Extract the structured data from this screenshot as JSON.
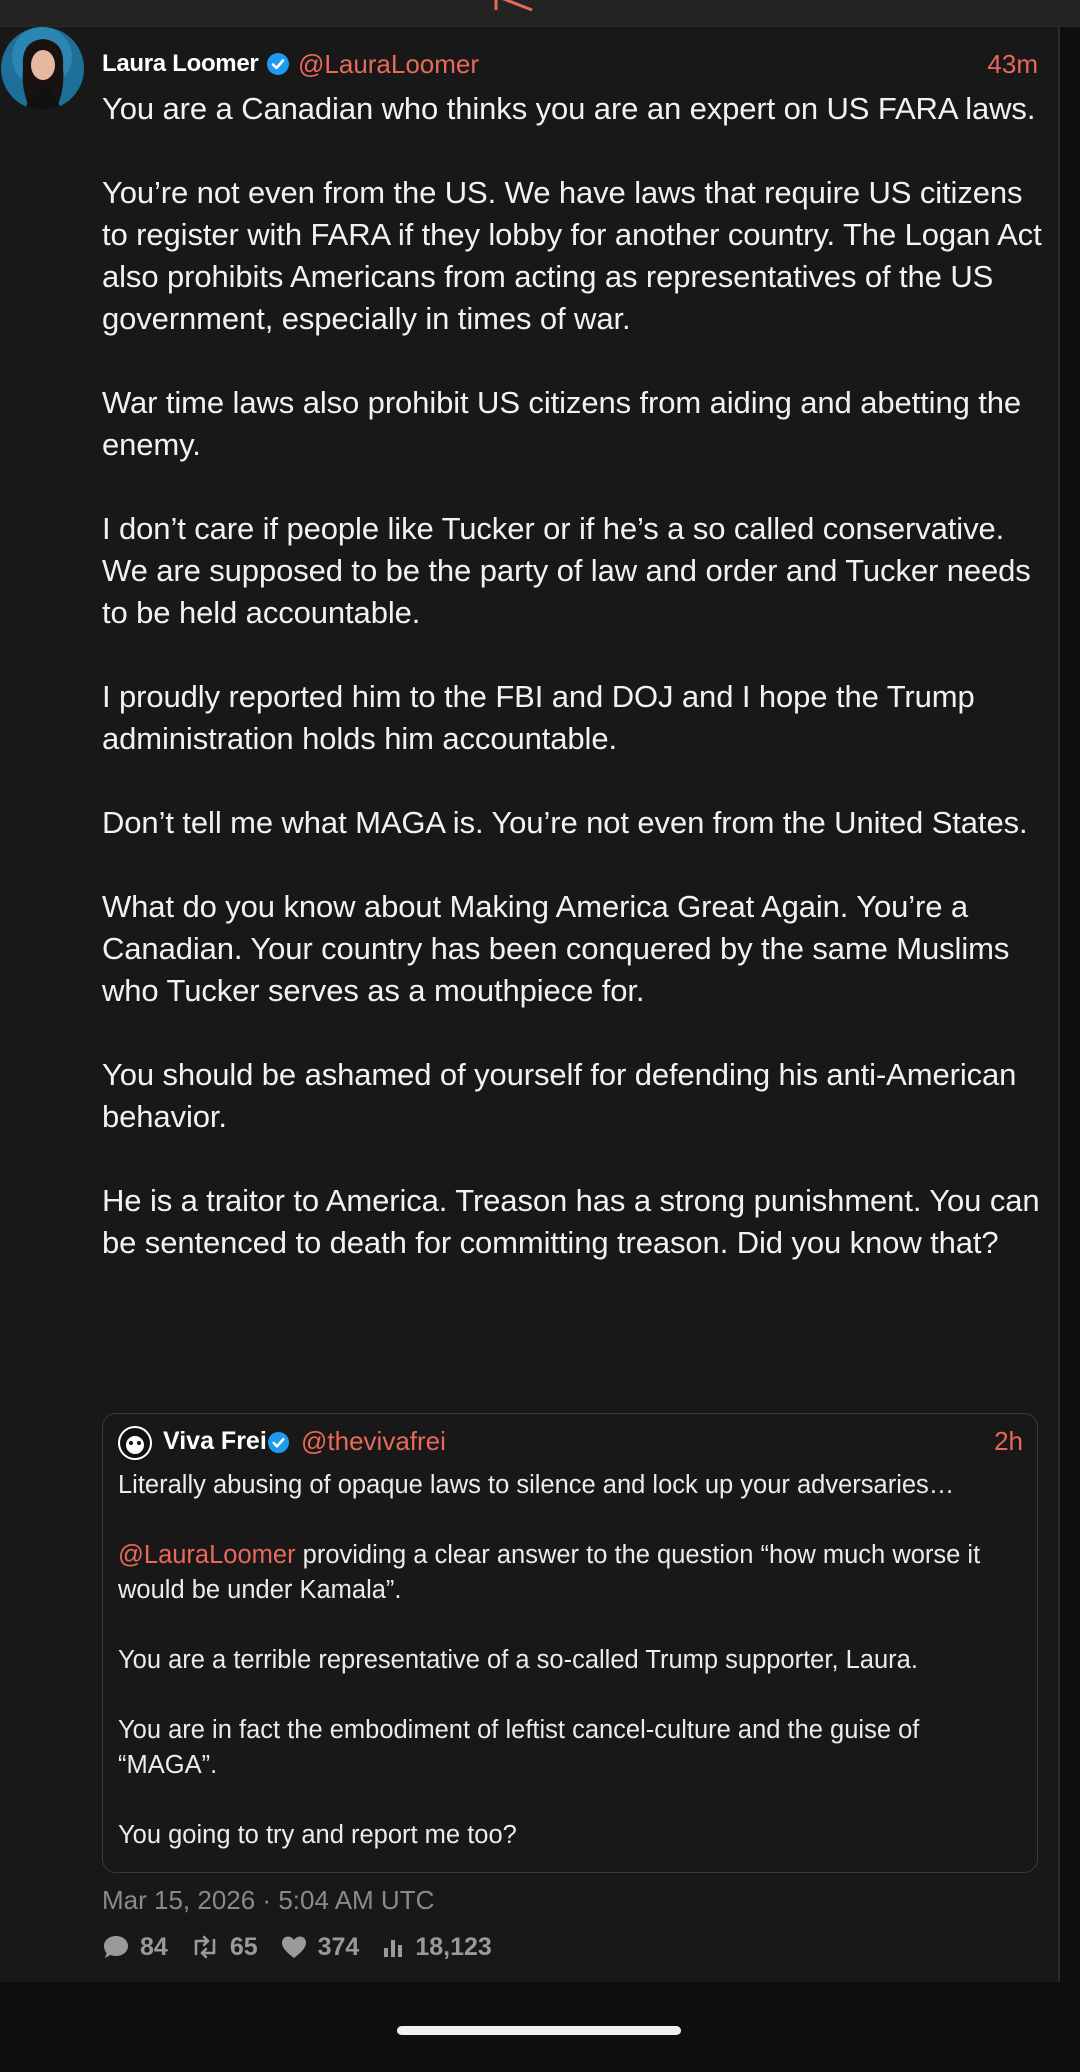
{
  "post": {
    "author_name": "Laura Loomer",
    "handle": "@LauraLoomer",
    "time": "43m",
    "paragraphs": [
      "You are a Canadian who thinks you are an expert on US FARA laws.",
      "You’re not even from the US. We have laws that require US citizens to register with FARA if they lobby for another country. The Logan Act also prohibits Americans from acting as representatives of the US government, especially in times of war.",
      "War time laws also prohibit US citizens from aiding and abetting the enemy.",
      "I don’t care if people like Tucker or if he’s a so called conservative. We are supposed to be the party of law and order and Tucker needs to be held accountable.",
      "I proudly reported him to the FBI and DOJ and I hope the Trump administration holds him accountable.",
      "Don’t tell me what MAGA is. You’re not even from the United States.",
      "What do you know about Making America Great Again. You’re a Canadian. Your country has been conquered by the same Muslims who Tucker serves as a mouthpiece for.",
      "You should be ashamed of yourself for defending his anti-American behavior.",
      "He is a traitor to America. Treason has a strong punishment. You can be sentenced to death for committing treason. Did you know that?"
    ],
    "date": "Mar 15, 2026 · 5:04 AM UTC",
    "stats": {
      "replies": "84",
      "reposts": "65",
      "likes": "374",
      "views": "18,123"
    }
  },
  "quote": {
    "author_name": "Viva Frei",
    "handle": "@thevivafrei",
    "time": "2h",
    "p1": "Literally abusing of opaque laws to silence and lock up your adversaries…",
    "p2_mention": "@LauraLoomer",
    "p2_rest": " providing a clear answer to the question “how much worse it would be under Kamala”.",
    "p3": "You are a terrible representative of a so-called Trump supporter, Laura.",
    "p4": "You are in fact the embodiment of leftist cancel-culture and the guise of “MAGA”.",
    "p5": "You going to try and report me too?"
  },
  "colors": {
    "accent": "#e8685a",
    "verified": "#1d9bf0",
    "background": "#181818"
  },
  "icons": [
    "verified-badge-icon",
    "reply-icon",
    "repost-icon",
    "like-icon",
    "views-icon"
  ]
}
